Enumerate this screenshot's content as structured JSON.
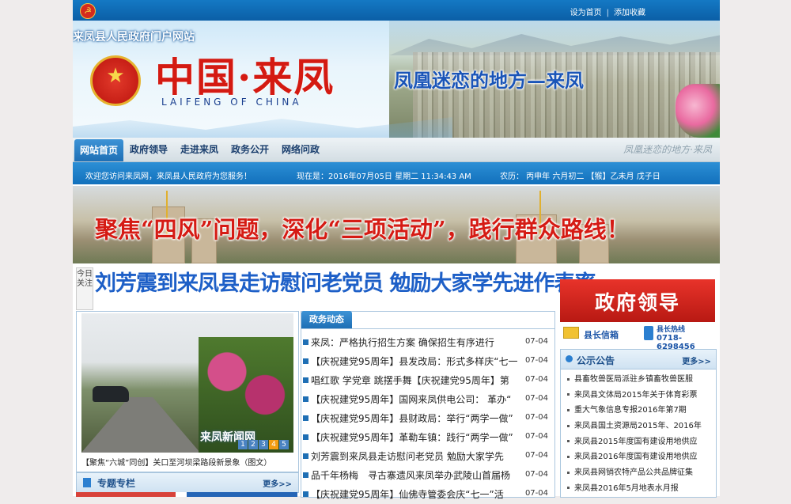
{
  "topbar": {
    "set_home": "设为首页",
    "separator": "|",
    "favorite": "添加收藏"
  },
  "banner": {
    "gov_title": "来凤县人民政府门户网站",
    "site_title": "中国·来凤",
    "site_subtitle": "LAIFENG OF CHINA",
    "slogan": "凤凰迷恋的地方—来凤"
  },
  "nav": {
    "items": [
      "网站首页",
      "政府领导",
      "走进来凤",
      "政务公开",
      "网络问政"
    ],
    "active_index": 0,
    "decoration": "凤凰迷恋的地方·来凤"
  },
  "infobar": {
    "welcome": "欢迎您访问来凤网，来凤县人民政府为您服务！",
    "now": "现在是：2016年07月05日 星期二 11:34:43 AM",
    "lunar": "农历： 丙申年 六月初二 【猴】乙未月 戊子日"
  },
  "banner2": {
    "slogan": "聚焦“四风”问题，深化“三项活动”，践行群众路线！"
  },
  "headline": {
    "tag": "今日关注",
    "text": "刘芳震到来凤县走访慰问老党员 勉励大家学先进作表率"
  },
  "photo": {
    "watermark": "来凤新闻网",
    "pager": [
      "1",
      "2",
      "3",
      "4",
      "5"
    ],
    "active_page": 4,
    "caption": "【聚焦“六城”同创】关口至河坝梁路段新景象（图文）"
  },
  "special": {
    "title": "专题专栏",
    "more": "更多>>"
  },
  "news": {
    "tab": "政务动态",
    "items": [
      {
        "title": "来凤：严格执行招生方案 确保招生有序进行",
        "date": "07-04"
      },
      {
        "title": "【庆祝建党95周年】县发改局：形式多样庆“七一",
        "date": "07-04"
      },
      {
        "title": "唱红歌 学党章 跳摆手舞【庆祝建党95周年】第",
        "date": "07-04"
      },
      {
        "title": "【庆祝建党95周年】国网来凤供电公司： 革办“",
        "date": "07-04"
      },
      {
        "title": "【庆祝建党95周年】县财政局：举行“两学一做”",
        "date": "07-04"
      },
      {
        "title": "【庆祝建党95周年】革勒车镇：践行“两学一做”",
        "date": "07-04"
      },
      {
        "title": "刘芳震到来凤县走访慰问老党员 勉励大家学先",
        "date": "07-04"
      },
      {
        "title": "品千年杨梅　寻古寨遗风来凤举办武陵山首届杨",
        "date": "07-04"
      },
      {
        "title": "【庆祝建党95周年】仙佛寺管委会庆“七一”活",
        "date": "07-04"
      }
    ]
  },
  "right": {
    "leaders": "政府领导",
    "mailbox": "县长信箱",
    "hotline_label": "县长热线",
    "hotline_number": "0718-6298456"
  },
  "notice": {
    "title": "公示公告",
    "more": "更多>>",
    "items": [
      "县畜牧兽医局派驻乡镇畜牧兽医服",
      "来凤县文体局2015年关于体育彩票",
      "重大气象信息专报2016年第7期",
      "来凤县国土资源局2015年、2016年",
      "来凤县2015年度国有建设用地供应",
      "来凤县2016年度国有建设用地供应",
      "来凤县网销农特产品公共品牌征集",
      "来凤县2016年5月地表水月报"
    ]
  },
  "colors": {
    "brand_blue": "#1270bc",
    "accent_red": "#d51b14"
  }
}
